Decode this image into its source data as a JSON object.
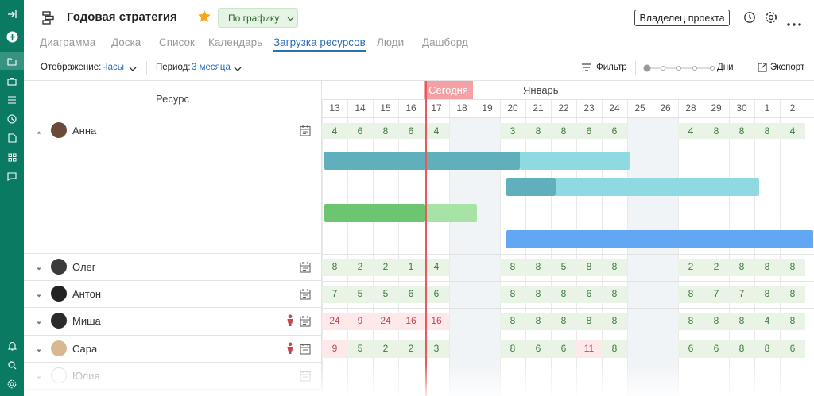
{
  "header": {
    "title": "Годовая стратегия",
    "status": "По графику",
    "owner": "Владелец проекта"
  },
  "tabs": [
    "Диаграмма",
    "Доска",
    "Список",
    "Календарь",
    "Загрузка ресурсов",
    "Люди",
    "Дашборд"
  ],
  "active_tab": "Загрузка ресурсов",
  "toolbar": {
    "display_label": "Отображение:",
    "display_value": "Часы",
    "period_label": "Период:",
    "period_value": "3 месяца",
    "filter": "Фильтр",
    "zoom_label": "Дни",
    "export": "Экспорт"
  },
  "grid": {
    "resource_header": "Ресурс",
    "month": "Январь",
    "today_label": "Сегодня",
    "days": [
      "13",
      "14",
      "15",
      "16",
      "17",
      "18",
      "19",
      "20",
      "21",
      "22",
      "23",
      "24",
      "25",
      "26",
      "28",
      "29",
      "30",
      "1",
      "2"
    ],
    "weekend_days": [
      "18",
      "19",
      "25",
      "26"
    ]
  },
  "resources": [
    {
      "name": "Анна",
      "expanded": true,
      "warning": false,
      "hours": [
        "4",
        "6",
        "8",
        "6",
        "4",
        "",
        "",
        "3",
        "8",
        "8",
        "6",
        "6",
        "",
        "",
        "4",
        "8",
        "8",
        "8",
        "4"
      ]
    },
    {
      "name": "Олег",
      "expanded": false,
      "warning": false,
      "hours": [
        "8",
        "2",
        "2",
        "1",
        "4",
        "",
        "",
        "8",
        "8",
        "5",
        "8",
        "8",
        "",
        "",
        "2",
        "2",
        "8",
        "8",
        "8"
      ]
    },
    {
      "name": "Антон",
      "expanded": false,
      "warning": false,
      "hours": [
        "7",
        "5",
        "5",
        "6",
        "6",
        "",
        "",
        "8",
        "8",
        "8",
        "6",
        "8",
        "",
        "",
        "8",
        "7",
        "7",
        "8",
        "8"
      ]
    },
    {
      "name": "Миша",
      "expanded": false,
      "warning": true,
      "hours": [
        "24",
        "9",
        "24",
        "16",
        "16",
        "",
        "",
        "8",
        "8",
        "8",
        "8",
        "8",
        "",
        "",
        "8",
        "8",
        "8",
        "4",
        "8"
      ]
    },
    {
      "name": "Сара",
      "expanded": false,
      "warning": true,
      "hours": [
        "9",
        "5",
        "2",
        "2",
        "3",
        "",
        "",
        "8",
        "6",
        "6",
        "11",
        "8",
        "",
        "",
        "6",
        "6",
        "8",
        "8",
        "6"
      ]
    },
    {
      "name": "Юлия",
      "expanded": false,
      "warning": false,
      "hours": []
    }
  ],
  "colors": {
    "rail": "#0b7a63",
    "accent": "#2a6fb8",
    "ok_cell": "#e9f4e7",
    "over_cell": "#fde8ea",
    "today": "#e9575f",
    "bar_teal_dark": "#5fb0bc",
    "bar_teal_light": "#8fd9e3",
    "bar_green_dark": "#6cc671",
    "bar_green_light": "#a8e3a6",
    "bar_blue": "#62a7f4"
  }
}
